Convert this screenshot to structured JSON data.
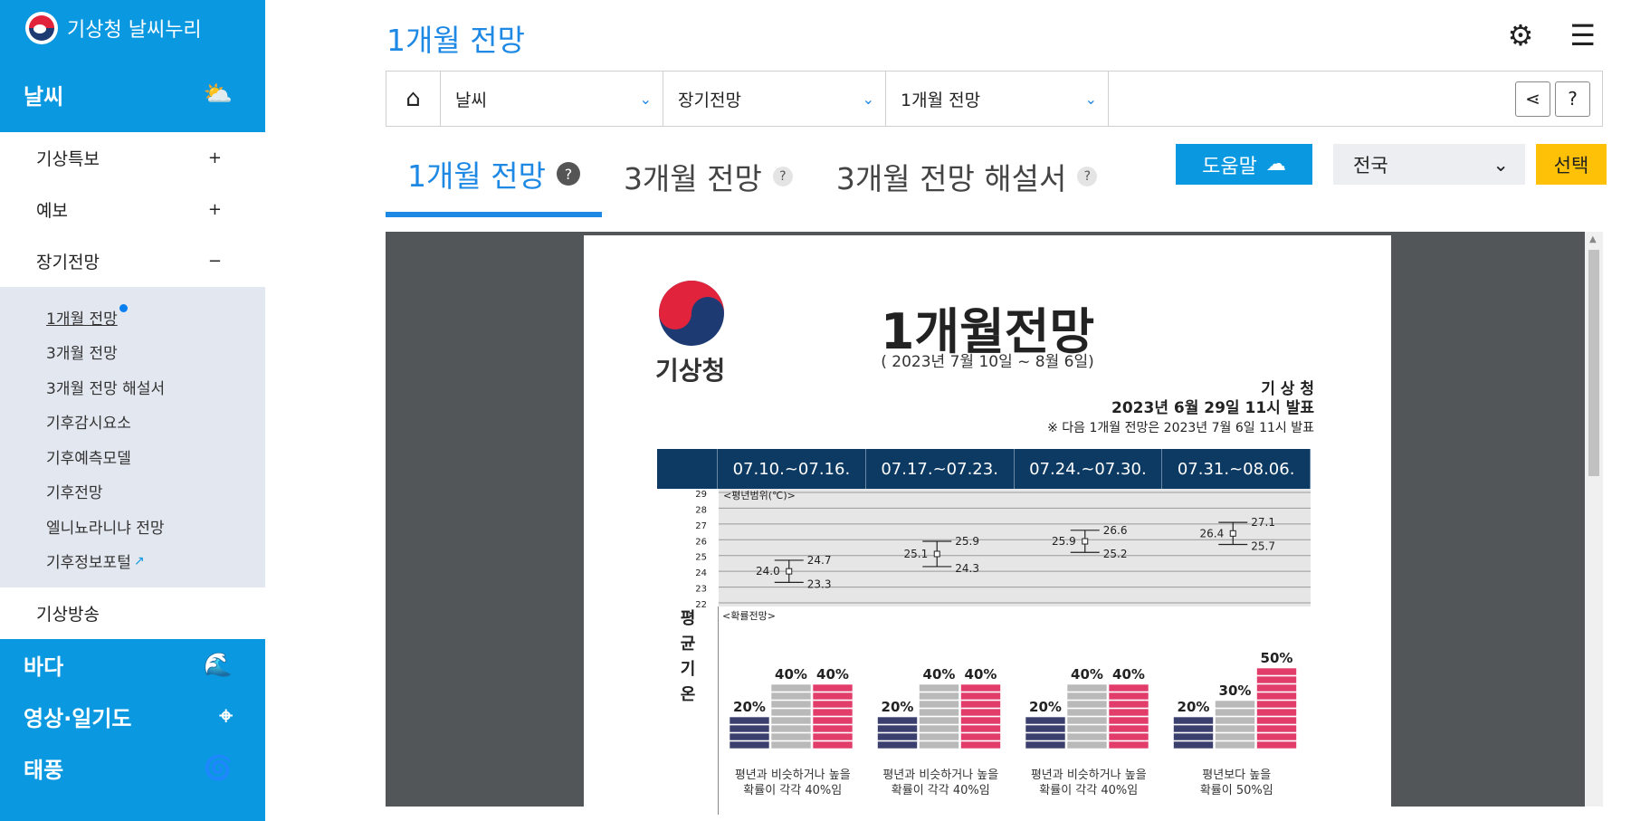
{
  "sidebar": {
    "brand": "기상청 날씨누리",
    "weather_section": "날씨",
    "items": [
      {
        "label": "기상특보",
        "sign": "+"
      },
      {
        "label": "예보",
        "sign": "+"
      },
      {
        "label": "장기전망",
        "sign": "−"
      }
    ],
    "sub_items": [
      "1개월 전망",
      "3개월 전망",
      "3개월 전망 해설서",
      "기후감시요소",
      "기후예측모델",
      "기후전망",
      "엘니뇨라니냐 전망",
      "기후정보포털"
    ],
    "broadcast": "기상방송",
    "sections": [
      "바다",
      "영상·일기도",
      "태풍"
    ]
  },
  "header": {
    "title": "1개월 전망"
  },
  "breadcrumb": {
    "level1": "날씨",
    "level2": "장기전망",
    "level3": "1개월 전망"
  },
  "tabs": [
    {
      "label": "1개월 전망"
    },
    {
      "label": "3개월 전망"
    },
    {
      "label": "3개월 전망 해설서"
    }
  ],
  "controls": {
    "help_label": "도움말",
    "region": "전국",
    "select_label": "선택"
  },
  "document": {
    "logo_text": "기상청",
    "title": "1개월전망",
    "period": "( 2023년 7월 10일 ~ 8월 6일)",
    "agency": "기 상 청",
    "issued": "2023년 6월 29일 11시 발표",
    "next_note": "※ 다음 1개월 전망은 2023년 7월 6일 11시 발표",
    "range_label": "<평년범위(℃)>",
    "prob_label": "<확률전망>",
    "row_title": [
      "평",
      "균",
      "기",
      "온"
    ],
    "weeks": [
      "07.10.~07.16.",
      "07.17.~07.23.",
      "07.24.~07.30.",
      "07.31.~08.06."
    ]
  },
  "chart_data": {
    "type": "table",
    "y_ticks": [
      29,
      28,
      27,
      26,
      25,
      24,
      23,
      22
    ],
    "normal_range": [
      {
        "week": "07.10.~07.16.",
        "low": 23.3,
        "mid": 24.0,
        "high": 24.7
      },
      {
        "week": "07.17.~07.23.",
        "low": 24.3,
        "mid": 25.1,
        "high": 25.9
      },
      {
        "week": "07.24.~07.30.",
        "low": 25.2,
        "mid": 25.9,
        "high": 26.6
      },
      {
        "week": "07.31.~08.06.",
        "low": 25.7,
        "mid": 26.4,
        "high": 27.1
      }
    ],
    "probability": [
      {
        "week": "07.10.~07.16.",
        "low": "20%",
        "normal": "40%",
        "high": "40%",
        "text": "평년과 비슷하거나 높을 확률이 각각 40%임"
      },
      {
        "week": "07.17.~07.23.",
        "low": "20%",
        "normal": "40%",
        "high": "40%",
        "text": "평년과 비슷하거나 높을 확률이 각각 40%임"
      },
      {
        "week": "07.24.~07.30.",
        "low": "20%",
        "normal": "40%",
        "high": "40%",
        "text": "평년과 비슷하거나 높을 확률이 각각 40%임"
      },
      {
        "week": "07.31.~08.06.",
        "low": "20%",
        "normal": "30%",
        "high": "50%",
        "text": "평년보다 높을 확률이 50%임"
      }
    ],
    "colors": {
      "low": "#3b3f6e",
      "normal": "#b9b9b9",
      "high": "#e23c6b",
      "header": "#0d3a63"
    }
  }
}
